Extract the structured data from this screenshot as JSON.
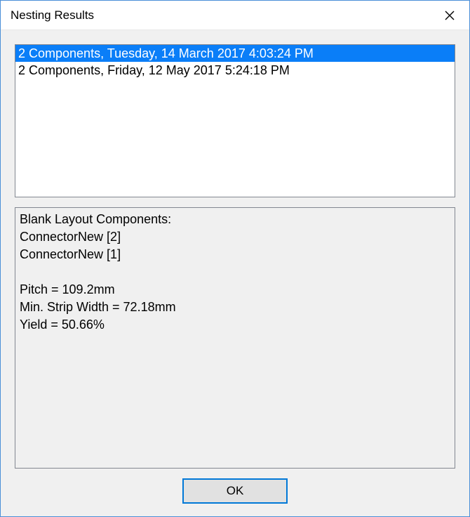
{
  "window": {
    "title": "Nesting Results"
  },
  "results_list": {
    "items": [
      {
        "label": "2 Components, Tuesday, 14 March 2017 4:03:24 PM",
        "selected": true
      },
      {
        "label": "2 Components, Friday, 12 May 2017 5:24:18 PM",
        "selected": false
      }
    ]
  },
  "details": {
    "text": "Blank Layout Components:\nConnectorNew [2]\nConnectorNew [1]\n\nPitch = 109.2mm\nMin. Strip Width = 72.18mm\nYield = 50.66%"
  },
  "buttons": {
    "ok": "OK"
  }
}
